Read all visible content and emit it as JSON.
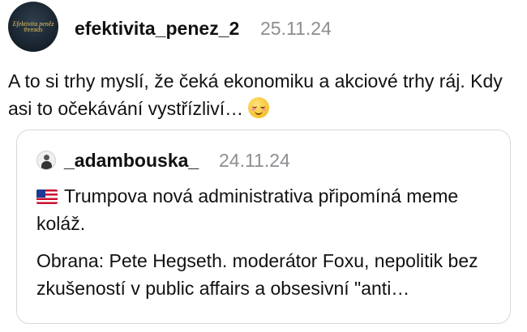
{
  "post": {
    "author": "efektivita_penez_2",
    "date": "25.11.24",
    "avatar_text": "Efektivita peněz",
    "avatar_subtext": "threads",
    "text": "A to si trhy myslí, že čeká ekonomiku a akciové trhy ráj. Kdy asi to očekávání vystřízliví…",
    "emoji": "smiling-face-icon"
  },
  "quoted_post": {
    "author": "_adambouska_",
    "date": "24.11.24",
    "flag": "us-flag-icon",
    "paragraph1": "Trumpova nová administrativa připomíná meme koláž.",
    "paragraph2": "Obrana: Pete Hegseth. moderátor Foxu, nepolitik bez zkušeností v public affairs a obsesivní \"anti…"
  },
  "colors": {
    "text": "#111111",
    "muted": "#8e8e93",
    "border": "#d9d9de"
  }
}
